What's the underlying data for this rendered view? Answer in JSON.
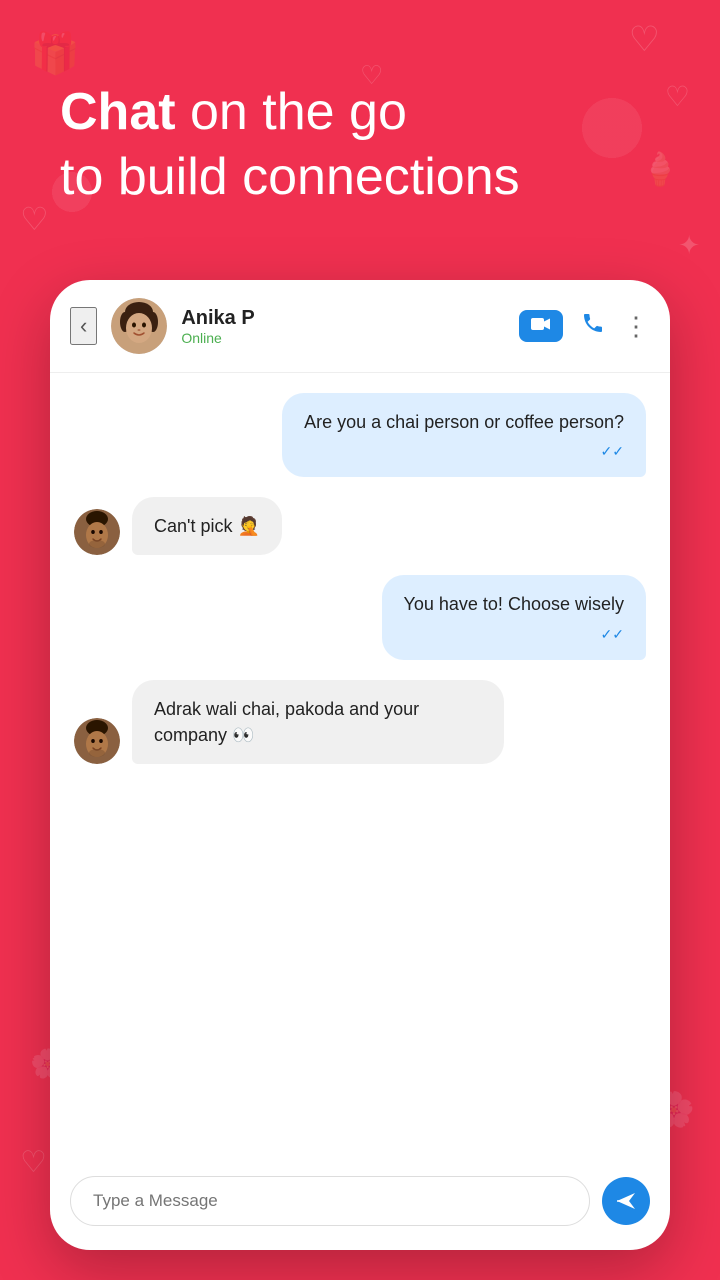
{
  "background": {
    "color": "#f03050"
  },
  "header": {
    "line1_bold": "Chat",
    "line1_rest": " on the go",
    "line2": "to build connections"
  },
  "chat": {
    "contact_name": "Anika P",
    "contact_status": "Online",
    "back_label": "‹",
    "more_label": "⋮",
    "messages": [
      {
        "id": "msg1",
        "type": "sent",
        "text": "Are you a chai person or coffee person?",
        "ticks": "✓✓"
      },
      {
        "id": "msg2",
        "type": "received",
        "text": "Can't pick 🤦",
        "avatar": "male"
      },
      {
        "id": "msg3",
        "type": "sent",
        "text": "You have to! Choose wisely",
        "ticks": "✓✓"
      },
      {
        "id": "msg4",
        "type": "received",
        "text": "Adrak wali chai, pakoda and your company 👀",
        "avatar": "male"
      }
    ],
    "input_placeholder": "Type a Message",
    "send_label": "➤"
  }
}
